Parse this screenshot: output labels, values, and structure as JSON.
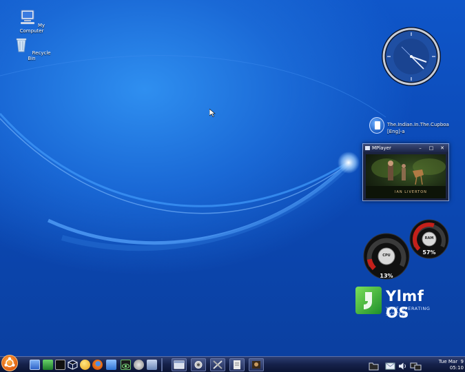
{
  "desktop": {
    "icons": [
      {
        "label": "My Computer",
        "icon": "computer-icon"
      },
      {
        "label": "Recycle Bin",
        "icon": "trash-icon"
      }
    ]
  },
  "file_item": {
    "label": "The.Indian.In.The.Cupboa [Eng]-a",
    "icon": "file-icon"
  },
  "mplayer": {
    "title": "MPlayer",
    "buttons": [
      "minimize",
      "maximize",
      "close"
    ],
    "caption": "IAN LIVERTON"
  },
  "gauges": {
    "cpu": {
      "label": "CPU",
      "value": "13%",
      "fraction": 0.13
    },
    "ram": {
      "label": "RAM",
      "value": "57%",
      "fraction": 0.57
    }
  },
  "logo": {
    "title": "Ylmf OS",
    "subtitle": "YLMF OPERATING SYSTEM"
  },
  "taskbar": {
    "start_icon": "ubuntu-logo-icon",
    "quick_launch": [
      "show-desktop-icon",
      "cleaner-icon",
      "terminal-icon",
      "box-icon",
      "smiley-icon",
      "firefox-icon",
      "text-editor-icon",
      "eye-icon",
      "camera-icon",
      "monitor-icon"
    ],
    "tasks": [
      "window-icon",
      "gear-icon",
      "tools-icon",
      "document-icon",
      "mplayer-icon"
    ],
    "tray": [
      "folder-icon",
      "mail-icon",
      "volume-icon",
      "network-icon"
    ],
    "clock": {
      "date": "Tue Mar  9",
      "time": "05:10"
    }
  },
  "colors": {
    "accent": "#1a69d6",
    "gauge_red": "#c4201a",
    "logo_green": "#3fb33a"
  }
}
